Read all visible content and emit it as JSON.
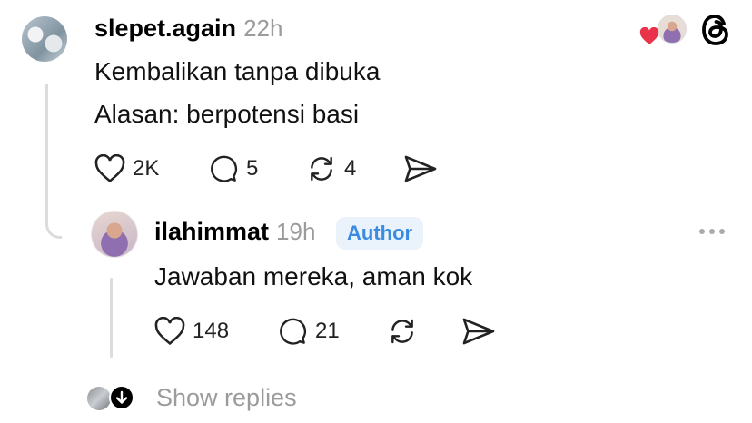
{
  "post": {
    "username": "slepet.again",
    "time": "22h",
    "line1": "Kembalikan tanpa dibuka",
    "line2": "Alasan: berpotensi basi",
    "likes": "2K",
    "comments": "5",
    "reposts": "4"
  },
  "reply": {
    "username": "ilahimmat",
    "time": "19h",
    "badge": "Author",
    "text": "Jawaban mereka, aman kok",
    "likes": "148",
    "comments": "21"
  },
  "footer": {
    "show_replies": "Show replies"
  },
  "icons": [
    "heart-icon",
    "comment-icon",
    "repost-icon",
    "share-icon",
    "threads-logo-icon",
    "more-icon",
    "down-arrow-icon"
  ],
  "colors": {
    "heart": "#e8334a",
    "author_badge_bg": "#eaf2fc",
    "author_badge_text": "#3b8be0"
  }
}
